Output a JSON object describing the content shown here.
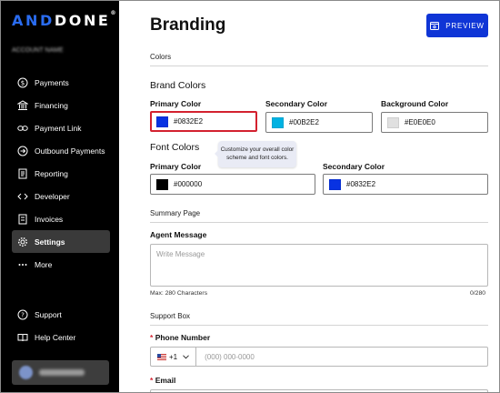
{
  "brand": {
    "logo_a": "AND",
    "logo_b": "DONE",
    "logo_mark": "®"
  },
  "account": {
    "name": "ACCOUNT NAME"
  },
  "nav": {
    "items": [
      {
        "label": "Payments",
        "icon": "dollar-icon"
      },
      {
        "label": "Financing",
        "icon": "bank-icon"
      },
      {
        "label": "Payment Link",
        "icon": "link-icon"
      },
      {
        "label": "Outbound Payments",
        "icon": "outbound-icon"
      },
      {
        "label": "Reporting",
        "icon": "report-icon"
      },
      {
        "label": "Developer",
        "icon": "code-icon"
      },
      {
        "label": "Invoices",
        "icon": "invoice-icon"
      },
      {
        "label": "Settings",
        "icon": "gear-icon",
        "active": true
      },
      {
        "label": "More",
        "icon": "more-icon"
      }
    ],
    "bottom": [
      {
        "label": "Support",
        "icon": "help-icon"
      },
      {
        "label": "Help Center",
        "icon": "book-icon"
      }
    ]
  },
  "user": {
    "name": "Thiago Souza"
  },
  "page": {
    "title": "Branding",
    "preview_label": "PREVIEW",
    "colors_section": "Colors",
    "brand_colors_heading": "Brand Colors",
    "primary_label": "Primary Color",
    "secondary_label": "Secondary Color",
    "background_label": "Background Color",
    "font_colors_heading": "Font Colors",
    "font_primary_label": "Primary Color",
    "font_secondary_label": "Secondary Color",
    "tooltip": "Customize your overall color scheme and font colors.",
    "summary_section": "Summary Page",
    "agent_message_label": "Agent Message",
    "agent_message_placeholder": "Write Message",
    "max_chars": "Max: 280 Characters",
    "char_count": "0/280",
    "support_section": "Support Box",
    "phone_label": "Phone Number",
    "country_code": "+1",
    "phone_placeholder": "(000) 000-0000",
    "email_label": "Email",
    "required_mark": "*"
  },
  "colors": {
    "brand_primary": "#0832E2",
    "brand_secondary": "#00B2E2",
    "brand_background": "#E0E0E0",
    "font_primary": "#000000",
    "font_secondary": "#0832E2"
  }
}
